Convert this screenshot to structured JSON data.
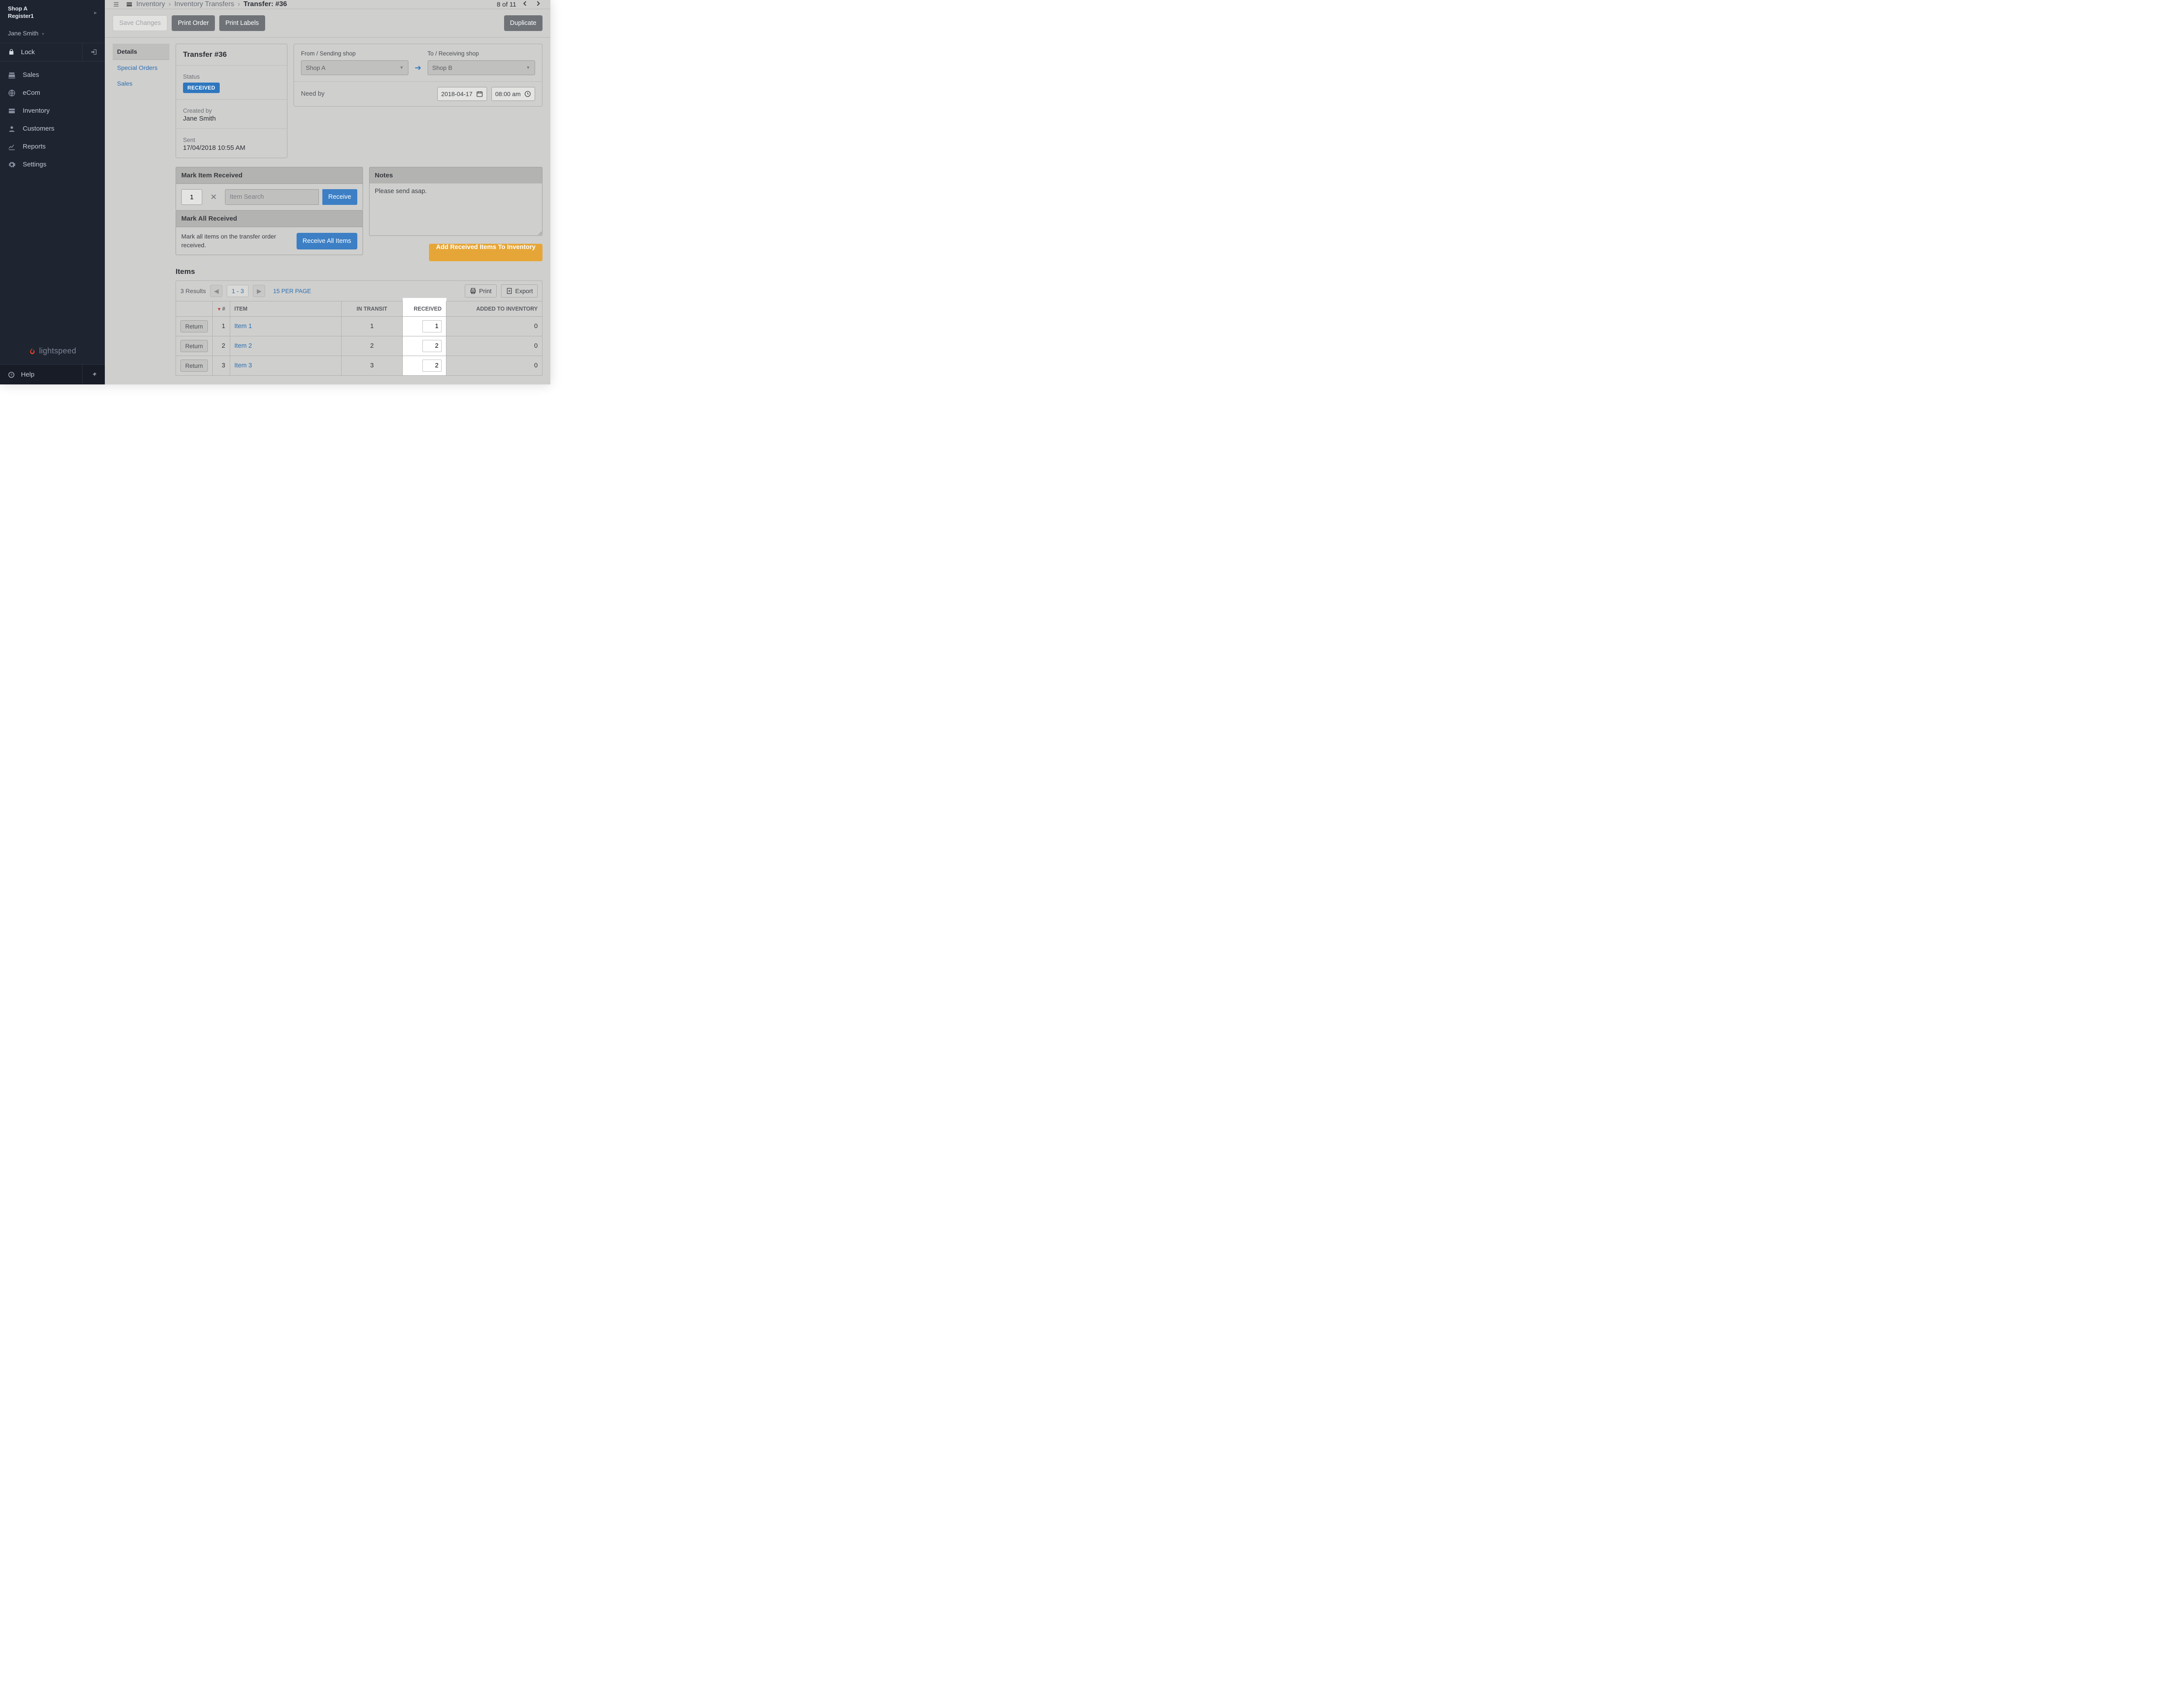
{
  "sidebar": {
    "shop": "Shop A",
    "register": "Register1",
    "user": "Jane Smith",
    "lock": "Lock",
    "nav": [
      {
        "label": "Sales"
      },
      {
        "label": "eCom"
      },
      {
        "label": "Inventory"
      },
      {
        "label": "Customers"
      },
      {
        "label": "Reports"
      },
      {
        "label": "Settings"
      }
    ],
    "brand": "lightspeed",
    "help": "Help"
  },
  "topbar": {
    "bc1": "Inventory",
    "bc2": "Inventory Transfers",
    "bc3": "Transfer: #36",
    "pager": "8 of 11"
  },
  "actions": {
    "save": "Save Changes",
    "print_order": "Print Order",
    "print_labels": "Print Labels",
    "duplicate": "Duplicate"
  },
  "subnav": {
    "details": "Details",
    "special": "Special Orders",
    "sales": "Sales"
  },
  "transfer": {
    "title": "Transfer #36",
    "status_lbl": "Status",
    "status": "RECEIVED",
    "created_lbl": "Created by",
    "created_by": "Jane Smith",
    "sent_lbl": "Sent",
    "sent_at": "17/04/2018 10:55 AM"
  },
  "fromto": {
    "from_lbl": "From / Sending shop",
    "from_val": "Shop A",
    "to_lbl": "To / Receiving shop",
    "to_val": "Shop B",
    "needby_lbl": "Need by",
    "needby_date": "2018-04-17",
    "needby_time": "08:00 am"
  },
  "mark": {
    "head": "Mark Item Received",
    "qty": "1",
    "placeholder": "Item Search",
    "receive": "Receive",
    "all_head": "Mark All Received",
    "all_txt": "Mark all items on the transfer order received.",
    "all_btn": "Receive All Items"
  },
  "notes": {
    "head": "Notes",
    "value": "Please send asap.",
    "add_btn": "Add Received Items To Inventory"
  },
  "items": {
    "heading": "Items",
    "results": "3 Results",
    "range": "1 - 3",
    "perpage": "15 PER PAGE",
    "print": "Print",
    "export": "Export",
    "cols": {
      "act": "",
      "num": "#",
      "item": "ITEM",
      "transit": "IN TRANSIT",
      "received": "RECEIVED",
      "added": "ADDED TO INVENTORY"
    },
    "return_lbl": "Return",
    "rows": [
      {
        "num": "1",
        "item": "Item 1",
        "transit": "1",
        "received": "1",
        "added": "0"
      },
      {
        "num": "2",
        "item": "Item 2",
        "transit": "2",
        "received": "2",
        "added": "0"
      },
      {
        "num": "3",
        "item": "Item 3",
        "transit": "3",
        "received": "2",
        "added": "0"
      }
    ]
  }
}
